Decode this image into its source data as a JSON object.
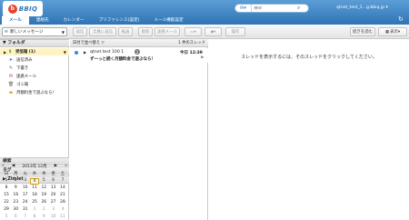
{
  "header": {
    "logo_mark": "b",
    "logo_text": "BBIQ",
    "search_placeholder": "検索",
    "user": "qtnet_test_1...g.bbiq.jp",
    "tabs": [
      "メール",
      "連絡先",
      "カレンダー",
      "プリファレンス(設定)",
      "メール機能設定"
    ]
  },
  "toolbar": {
    "new_message": "新しいメッセージ",
    "buttons": [
      "返信",
      "全員に返信",
      "転送",
      "削除",
      "迷惑メール"
    ],
    "more": "操作",
    "read_more": "続きを読む",
    "view": "表示"
  },
  "sidebar": {
    "folder_header": "フォルダ",
    "folders": [
      {
        "name": "受信箱 (1)",
        "icon": "inbox-icon"
      },
      {
        "name": "送信済み",
        "icon": "sent-icon"
      },
      {
        "name": "下書き",
        "icon": "drafts-icon"
      },
      {
        "name": "迷惑メール",
        "icon": "junk-icon"
      },
      {
        "name": "ゴミ箱",
        "icon": "trash-icon"
      },
      {
        "name": "月額料金で遊ぶなら！",
        "icon": "folder-icon"
      }
    ],
    "search_header": "検索",
    "tags_header": "タグ",
    "zimlet_header": "Zimlet"
  },
  "calendar": {
    "month": "2013年 12月",
    "weekdays": [
      "日",
      "月",
      "火",
      "水",
      "木",
      "金",
      "土"
    ],
    "weeks": [
      [
        "1",
        "2",
        "3",
        "4",
        "5",
        "6",
        "7"
      ],
      [
        "8",
        "9",
        "10",
        "11",
        "12",
        "13",
        "14"
      ],
      [
        "15",
        "16",
        "17",
        "18",
        "19",
        "20",
        "21"
      ],
      [
        "22",
        "23",
        "24",
        "25",
        "26",
        "27",
        "28"
      ],
      [
        "29",
        "30",
        "31",
        "1",
        "2",
        "3",
        "4"
      ],
      [
        "5",
        "6",
        "7",
        "8",
        "9",
        "10",
        "11"
      ]
    ],
    "today": "4"
  },
  "message_list": {
    "sort_label": "日付で並べ替え",
    "count": "1 件のスレッド",
    "rows": [
      {
        "sender": "qtnet test 100 1",
        "thread_count": "2",
        "time": "今日 12:39",
        "subject": "ずーっと続く月額料金で遊ぶなら！"
      }
    ]
  },
  "reading_pane": {
    "hint": "スレッドを表示するには、そのスレッドをクリックしてください。"
  }
}
